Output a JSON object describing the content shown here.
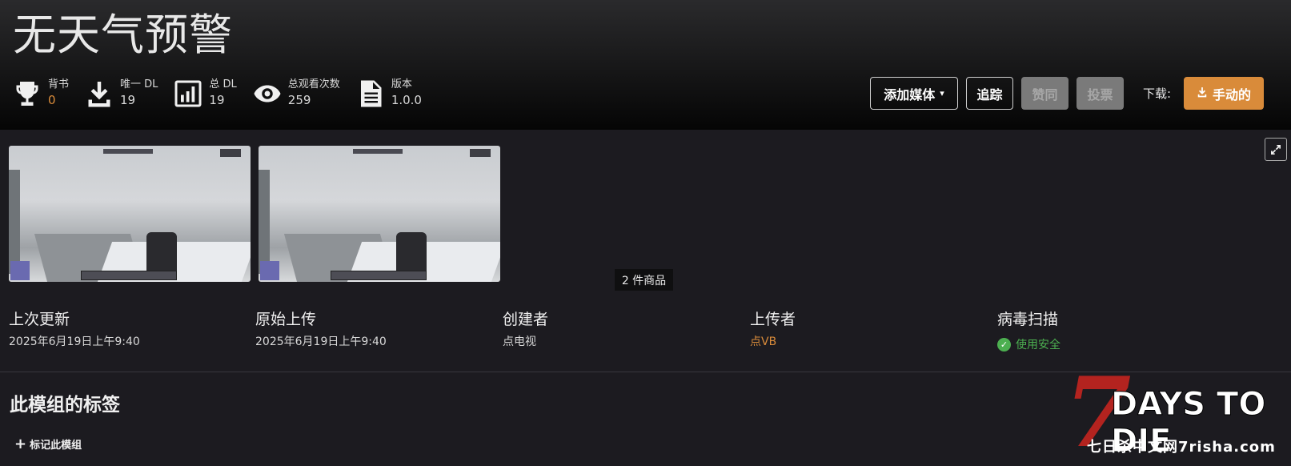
{
  "title": "无天气预警",
  "stats": [
    {
      "icon": "trophy-icon",
      "label": "背书",
      "value": "0",
      "accent": "#d98b3a"
    },
    {
      "icon": "download-icon",
      "label": "唯一 DL",
      "value": "19"
    },
    {
      "icon": "bar-chart-icon",
      "label": "总 DL",
      "value": "19"
    },
    {
      "icon": "eye-icon",
      "label": "总观看次数",
      "value": "259"
    },
    {
      "icon": "document-icon",
      "label": "版本",
      "value": "1.0.0"
    }
  ],
  "actions": {
    "add_media": "添加媒体",
    "track": "追踪",
    "endorse": "赞同",
    "vote": "投票",
    "download_label": "下载:",
    "manual": "手动的"
  },
  "gallery": {
    "count_label": "2 件商品"
  },
  "info": {
    "last_updated": {
      "head": "上次更新",
      "value": "2025年6月19日上午9:40"
    },
    "original_upload": {
      "head": "原始上传",
      "value": "2025年6月19日上午9:40"
    },
    "creator": {
      "head": "创建者",
      "value": "点电视"
    },
    "uploader": {
      "head": "上传者",
      "value": "点VB"
    },
    "virus_scan": {
      "head": "病毒扫描",
      "value": "使用安全"
    }
  },
  "tags": {
    "title": "此模组的标签",
    "add": "标记此模组"
  },
  "watermark": {
    "seven": "7",
    "days": "DAYS TO DIE",
    "site": "七日杀中文网7risha.com"
  },
  "colors": {
    "accent": "#d98b3a",
    "safe": "#4caf50",
    "background": "#1c1b20"
  }
}
